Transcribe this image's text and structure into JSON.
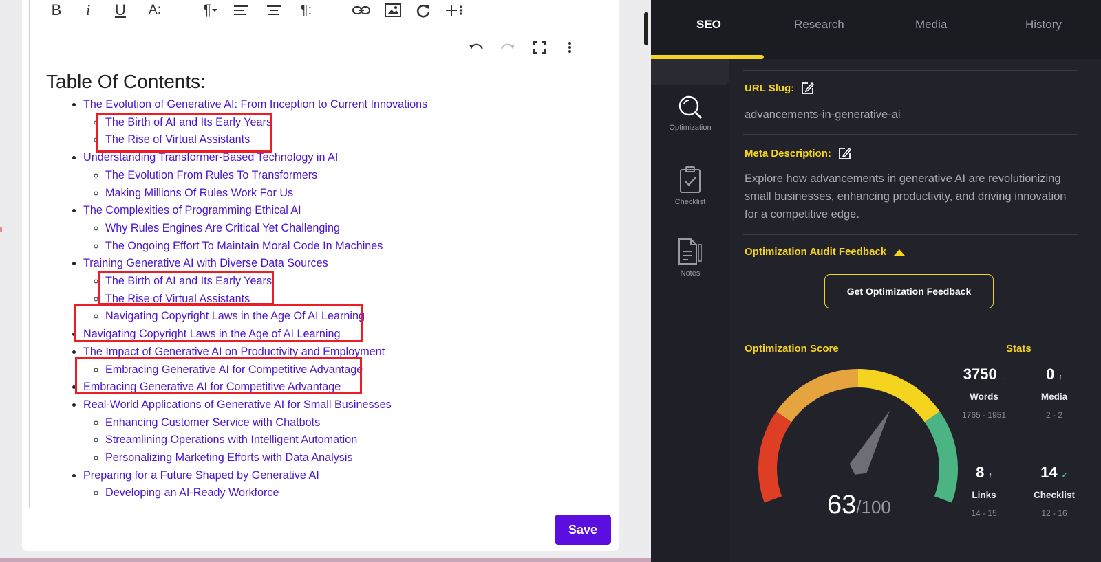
{
  "editor": {
    "toolbar": {
      "bold": "B",
      "italic": "i",
      "underline": "U",
      "font_size": "A:",
      "paragraph": "¶",
      "paragraph_format": "¶:"
    },
    "heading": "Table Of Contents:",
    "toc": [
      {
        "text": "The Evolution of Generative AI: From Inception to Current Innovations",
        "children": [
          "The Birth of AI and Its Early Years",
          "The Rise of Virtual Assistants"
        ]
      },
      {
        "text": "Understanding Transformer-Based Technology in AI",
        "children": [
          "The Evolution From Rules To Transformers",
          "Making Millions Of Rules Work For Us"
        ]
      },
      {
        "text": "The Complexities of Programming Ethical AI",
        "children": [
          "Why Rules Engines Are Critical Yet Challenging",
          "The Ongoing Effort To Maintain Moral Code In Machines"
        ]
      },
      {
        "text": "Training Generative AI with Diverse Data Sources",
        "children": [
          "The Birth of AI and Its Early Years",
          "The Rise of Virtual Assistants",
          "Navigating Copyright Laws in the Age Of AI Learning"
        ]
      },
      {
        "text": "Navigating Copyright Laws in the Age of AI Learning",
        "children": []
      },
      {
        "text": "The Impact of Generative AI on Productivity and Employment",
        "children": [
          "Embracing Generative AI for Competitive Advantage"
        ]
      },
      {
        "text": "Embracing Generative AI for Competitive Advantage",
        "children": []
      },
      {
        "text": "Real-World Applications of Generative AI for Small Businesses",
        "children": [
          "Enhancing Customer Service with Chatbots",
          "Streamlining Operations with Intelligent Automation",
          "Personalizing Marketing Efforts with Data Analysis"
        ]
      },
      {
        "text": "Preparing for a Future Shaped by Generative AI",
        "children": [
          "Developing an AI-Ready Workforce"
        ]
      }
    ],
    "save_label": "Save"
  },
  "panel": {
    "tabs": [
      "SEO",
      "Research",
      "Media",
      "History"
    ],
    "active_tab": "SEO",
    "rail": [
      "Optimization",
      "Checklist",
      "Notes"
    ],
    "url_slug_label": "URL Slug:",
    "url_slug": "advancements-in-generative-ai",
    "meta_label": "Meta Description:",
    "meta_description": "Explore how advancements in generative AI are revolutionizing small businesses, enhancing productivity, and driving innovation for a competitive edge.",
    "audit_label": "Optimization Audit Feedback",
    "feedback_button": "Get Optimization Feedback",
    "score_label": "Optimization Score",
    "stats_label": "Stats",
    "score": 63,
    "score_max": "/100",
    "stats": [
      {
        "value": "3750",
        "arrow": "↓",
        "arrow_color": "#e5532d",
        "name": "Words",
        "range": "1765 - 1951"
      },
      {
        "value": "0",
        "arrow": "↑",
        "arrow_color": "#ffffff",
        "name": "Media",
        "range": "2 - 2"
      },
      {
        "value": "8",
        "arrow": "↑",
        "arrow_color": "#ffffff",
        "name": "Links",
        "range": "14 - 15"
      },
      {
        "value": "14",
        "arrow": "✓",
        "arrow_color": "#4cbb7f",
        "name": "Checklist",
        "range": "12 - 16"
      }
    ]
  },
  "colors": {
    "accent": "#f5d41f",
    "save": "#5a0fe0",
    "link": "#4b16cc",
    "highlight": "#ee1c25",
    "gauge": [
      "#dd3e24",
      "#e5a43e",
      "#f5d41f",
      "#4cb382"
    ]
  }
}
